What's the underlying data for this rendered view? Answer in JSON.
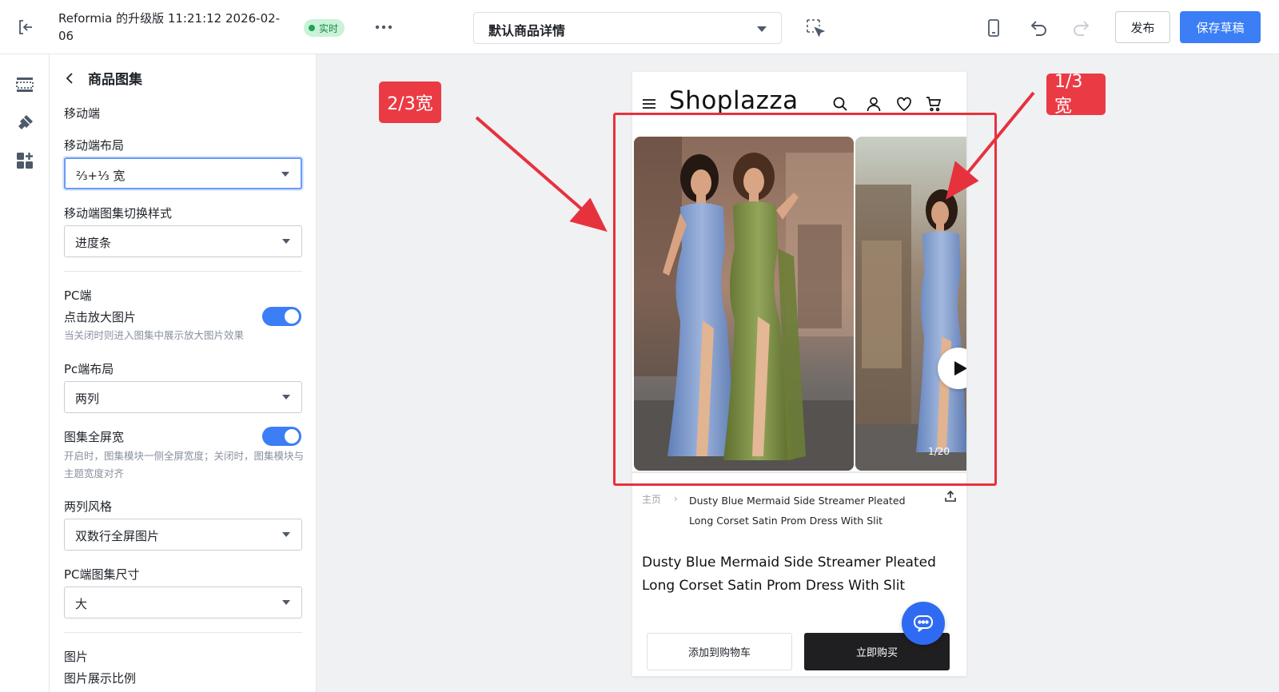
{
  "topbar": {
    "title": "Reformia 的升级版 11:21:12 2026-02-06",
    "live_label": "实时",
    "page_select": "默认商品详情",
    "publish_label": "发布",
    "save_label": "保存草稿"
  },
  "panel": {
    "title": "商品图集",
    "mobile_section": "移动端",
    "mobile_layout_label": "移动端布局",
    "mobile_layout_value": "⅔+⅓ 宽",
    "mobile_switch_label": "移动端图集切换样式",
    "mobile_switch_value": "进度条",
    "pc_section": "PC端",
    "zoom_label": "点击放大图片",
    "zoom_help": "当关闭时则进入图集中展示放大图片效果",
    "pc_layout_label": "Pc端布局",
    "pc_layout_value": "两列",
    "fullwidth_label": "图集全屏宽",
    "fullwidth_help": "开启时，图集模块一侧全屏宽度；关闭时，图集模块与主题宽度对齐",
    "two_col_style_label": "两列风格",
    "two_col_style_value": "双数行全屏图片",
    "pc_size_label": "PC端图集尺寸",
    "pc_size_value": "大",
    "image_section": "图片",
    "image_ratio_label": "图片展示比例"
  },
  "preview": {
    "logo": "Shoplazza",
    "counter": "1/20",
    "breadcrumb_home": "主页",
    "breadcrumb_sep": "›",
    "breadcrumb_current": "Dusty Blue Mermaid Side Streamer Pleated Long Corset Satin Prom Dress With Slit",
    "product_title": "Dusty Blue Mermaid Side Streamer Pleated Long Corset Satin Prom Dress With Slit",
    "add_to_cart": "添加到购物车",
    "buy_now": "立即购买"
  },
  "annotations": {
    "left_tag": "2/3宽",
    "right_tag": "1/3宽"
  },
  "colors": {
    "accent": "#3b7ef5",
    "annotation_red": "#e6323d",
    "live_green": "#1fa350"
  },
  "icons": [
    "exit-icon",
    "more-icon",
    "select-element-icon",
    "mobile-device-icon",
    "undo-icon",
    "redo-icon",
    "layout-icon",
    "brush-icon",
    "components-icon",
    "back-chevron-icon",
    "menu-icon",
    "search-icon",
    "user-icon",
    "heart-icon",
    "cart-icon",
    "play-icon",
    "share-icon",
    "chat-icon"
  ]
}
